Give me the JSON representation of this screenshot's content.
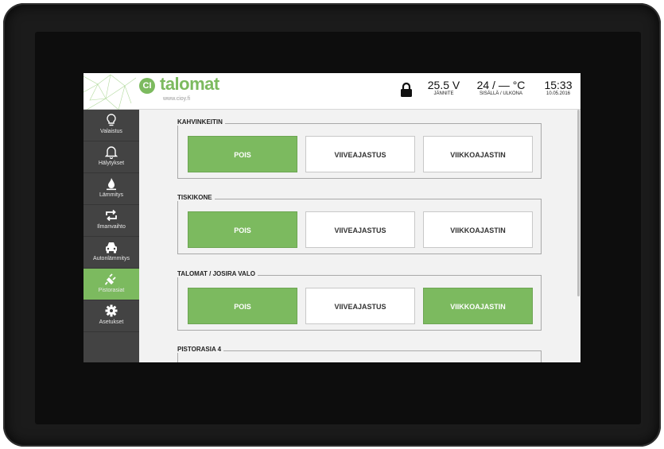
{
  "header": {
    "logo_badge": "CI",
    "logo_text": "talomat",
    "logo_url": "www.cioy.fi",
    "voltage": {
      "value": "25.5 V",
      "label": "JÄNNITE"
    },
    "temperature": {
      "value": "24 / — °C",
      "label": "SISÄLLÄ / ULKONA"
    },
    "clock": {
      "time": "15:33",
      "date": "10.05.2016"
    }
  },
  "sidebar": {
    "items": [
      {
        "label": "Valaistus",
        "icon": "lightbulb-icon",
        "active": false
      },
      {
        "label": "Hälytykset",
        "icon": "bell-icon",
        "active": false
      },
      {
        "label": "Lämmitys",
        "icon": "flame-icon",
        "active": false
      },
      {
        "label": "Ilmanvaihto",
        "icon": "recycle-icon",
        "active": false
      },
      {
        "label": "Autonlämmitys",
        "icon": "car-icon",
        "active": false
      },
      {
        "label": "Pistorasiat",
        "icon": "plug-icon",
        "active": true
      },
      {
        "label": "Asetukset",
        "icon": "gear-icon",
        "active": false
      }
    ]
  },
  "groups": [
    {
      "title": "KAHVINKEITIN",
      "buttons": [
        "POIS",
        "VIIVEAJASTUS",
        "VIIKKOAJASTIN"
      ],
      "active": "POIS"
    },
    {
      "title": "TISKIKONE",
      "buttons": [
        "POIS",
        "VIIVEAJASTUS",
        "VIIKKOAJASTIN"
      ],
      "active": "POIS"
    },
    {
      "title": "TALOMAT / JOSIRA VALO",
      "buttons": [
        "POIS",
        "VIIVEAJASTUS",
        "VIIKKOAJASTIN"
      ],
      "active": "POIS, VIIKKOAJASTIN"
    },
    {
      "title": "PISTORASIA 4",
      "buttons": [],
      "active": ""
    }
  ],
  "colors": {
    "accent": "#7cba5f",
    "sidebar": "#434343",
    "bezel": "#1b1b1b"
  }
}
